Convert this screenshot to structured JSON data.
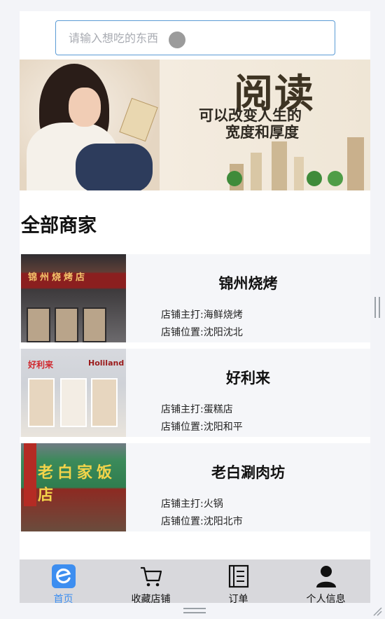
{
  "search": {
    "placeholder": "请输入想吃的东西"
  },
  "banner": {
    "title": "阅读",
    "line1": "可以改变人生的",
    "line2": "宽度和厚度"
  },
  "section": {
    "title": "全部商家"
  },
  "shops": [
    {
      "name": "锦州烧烤",
      "main": "店铺主打:海鲜烧烤",
      "location": "店铺位置:沈阳沈北",
      "photo_sign": "锦州烧烤店"
    },
    {
      "name": "好利来",
      "main": "店铺主打:蛋糕店",
      "location": "店铺位置:沈阳和平",
      "photo_sign": "好利来",
      "photo_sign2": "Holiland"
    },
    {
      "name": "老白涮肉坊",
      "main": "店铺主打:火锅",
      "location": "店铺位置:沈阳北市",
      "photo_sign": "老白家饭店"
    }
  ],
  "tabs": [
    {
      "label": "首页",
      "icon": "home-e-icon",
      "active": true
    },
    {
      "label": "收藏店铺",
      "icon": "cart-icon",
      "active": false
    },
    {
      "label": "订单",
      "icon": "order-list-icon",
      "active": false
    },
    {
      "label": "个人信息",
      "icon": "person-icon",
      "active": false
    }
  ],
  "colors": {
    "accent": "#3d8ef0",
    "tabbar_bg": "#d8d8dc",
    "search_border": "#5b9bd5"
  }
}
